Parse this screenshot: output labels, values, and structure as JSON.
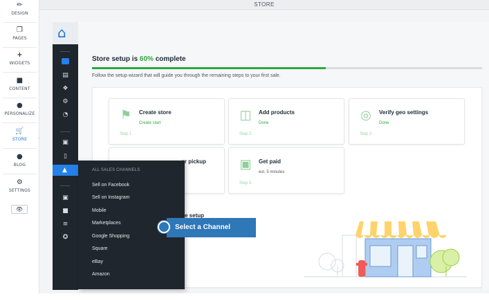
{
  "header": {
    "title": "STORE"
  },
  "editor_sidebar": {
    "items": [
      {
        "label": "DESIGN",
        "icon": "brush-icon"
      },
      {
        "label": "PAGES",
        "icon": "pages-icon"
      },
      {
        "label": "WIDGETS",
        "icon": "plus-icon"
      },
      {
        "label": "CONTENT",
        "icon": "folder-icon"
      },
      {
        "label": "PERSONALIZE",
        "icon": "person-icon"
      },
      {
        "label": "STORE",
        "icon": "cart-icon"
      },
      {
        "label": "BLOG",
        "icon": "chat-icon"
      },
      {
        "label": "SETTINGS",
        "icon": "gear-icon"
      }
    ],
    "active": "STORE"
  },
  "setup": {
    "title_prefix": "Store setup is ",
    "title_pct": "60%",
    "title_suffix": " complete",
    "progress": 0.6,
    "subtitle": "Follow the setup wizard that will guide you through the remaining steps to your first sale."
  },
  "tasks": [
    {
      "name": "Create store",
      "status": "Create start",
      "step": "Step 1"
    },
    {
      "name": "Add products",
      "status": "Done",
      "step": "Step 2"
    },
    {
      "name": "Verify geo settings",
      "status": "Done",
      "step": "Step 3"
    },
    {
      "name": "or pickup",
      "status": "",
      "step": ""
    },
    {
      "name": "Get paid",
      "status": "est. 5 minutes",
      "step": "Step 5"
    }
  ],
  "partial_text": {
    "setup_fragment": "e setup"
  },
  "dropdown": {
    "header": "ALL SALES CHANNELS",
    "items": [
      "Sell on Facebook",
      "Sell on Instagram",
      "Mobile",
      "Marketplaces",
      "Google Shopping",
      "Square",
      "eBay",
      "Amazon"
    ]
  },
  "tooltip": {
    "text": "Select a Channel"
  },
  "colors": {
    "accent": "#2ca93f",
    "brand_blue": "#1f6fd6",
    "dark_bar": "#20262e",
    "tooltip": "#2e77b8"
  }
}
